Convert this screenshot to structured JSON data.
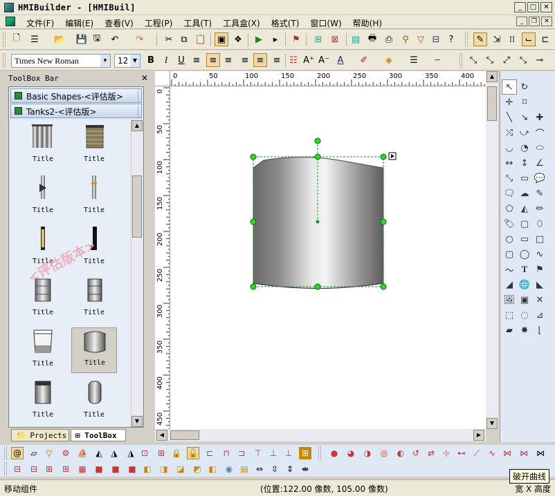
{
  "window": {
    "title": "HMIBuilder - [HMIBuil]"
  },
  "menu": [
    "文件(F)",
    "编辑(E)",
    "查看(V)",
    "工程(P)",
    "工具(T)",
    "工具盒(X)",
    "格式(T)",
    "窗口(W)",
    "帮助(H)"
  ],
  "format_bar": {
    "font_name": "Times New Roman",
    "font_size": "12"
  },
  "toolbox": {
    "header": "ToolBox Bar",
    "categories": [
      "Basic Shapes-<评估版>",
      "Tanks2-<评估版>"
    ],
    "items": [
      {
        "label": "Title",
        "icon": "tank-pipes-icon"
      },
      {
        "label": "Title",
        "icon": "brick-tank-icon"
      },
      {
        "label": "Title",
        "icon": "valve-pipe-icon"
      },
      {
        "label": "Title",
        "icon": "pipe-segment-icon"
      },
      {
        "label": "Title",
        "icon": "gauge-rod-icon"
      },
      {
        "label": "Title",
        "icon": "dark-rod-icon"
      },
      {
        "label": "Title",
        "icon": "drum-icon"
      },
      {
        "label": "Title",
        "icon": "drum-dark-icon"
      },
      {
        "label": "Title",
        "icon": "bucket-icon"
      },
      {
        "label": "Title",
        "icon": "tank-cylinder-icon"
      },
      {
        "label": "Title",
        "icon": "column-tank-icon"
      },
      {
        "label": "Title",
        "icon": "capsule-tank-icon"
      }
    ],
    "watermark": "<评估版本>",
    "tabs": [
      "Projects",
      "ToolBox"
    ]
  },
  "ruler": {
    "h_labels": [
      "0",
      "50",
      "100",
      "150",
      "200",
      "250",
      "300",
      "350",
      "400"
    ],
    "v_labels": [
      "0",
      "50",
      "100",
      "150",
      "200",
      "250",
      "300",
      "350",
      "400",
      "450"
    ]
  },
  "status": {
    "left": "移动组件",
    "position": "(位置:122.00 像数, 105.00 像数)",
    "right": "宽 X 高度"
  },
  "tooltip": "破开曲线"
}
